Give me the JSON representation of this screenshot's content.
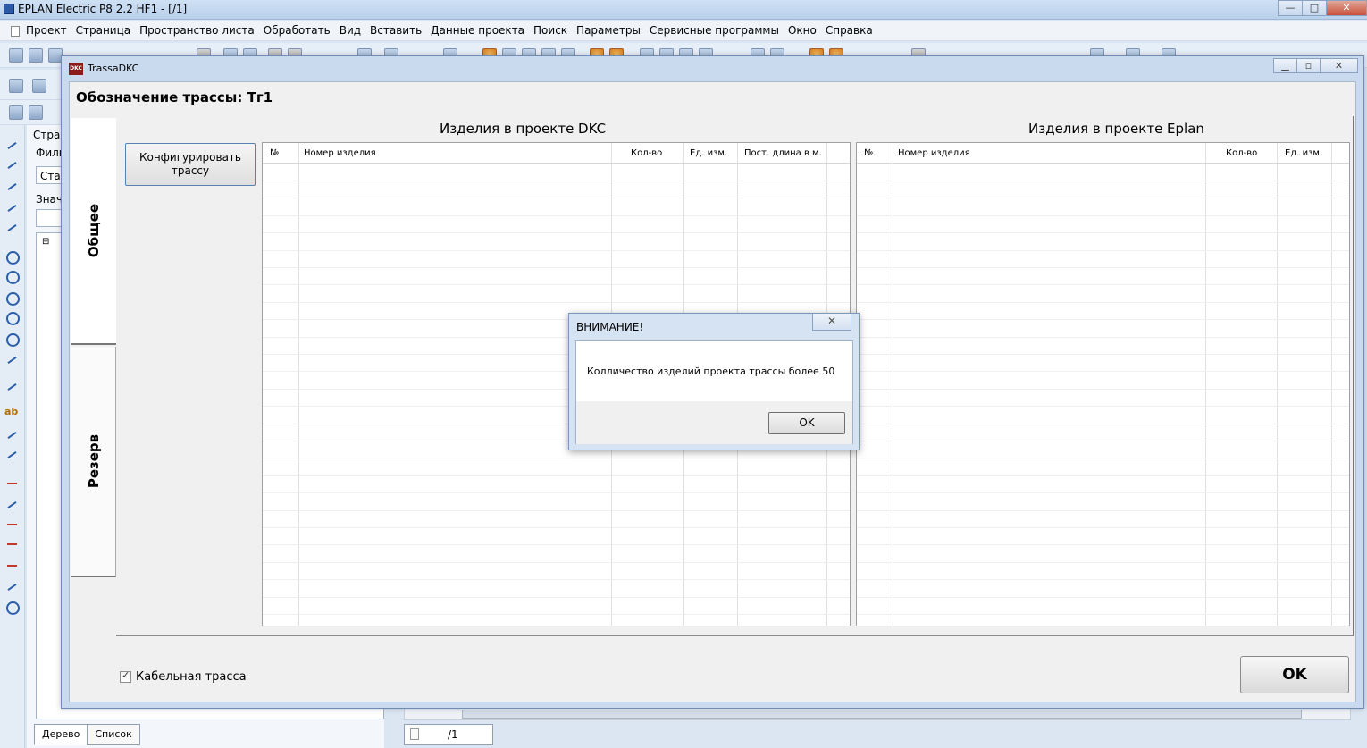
{
  "app": {
    "title": "EPLAN Electric P8 2.2 HF1 - [/1]",
    "menu": [
      "Проект",
      "Страница",
      "Пространство листа",
      "Обработать",
      "Вид",
      "Вставить",
      "Данные проекта",
      "Поиск",
      "Параметры",
      "Сервисные программы",
      "Окно",
      "Справка"
    ]
  },
  "nav_panel": {
    "fragments": [
      "Стран",
      "Филь",
      "Стан",
      "Знач"
    ],
    "tabs": [
      "Дерево",
      "Список"
    ]
  },
  "page_tab": "/1",
  "dialog": {
    "title": "TrassaDKC",
    "icon_text": "DKC",
    "route_title": "Обозначение трассы: Тг1",
    "side_tabs": [
      "Общее",
      "Резерв"
    ],
    "configure_button": "Конфигурировать трассу",
    "dkc_grid": {
      "caption": "Изделия в проекте DKC",
      "columns": [
        "№",
        "Номер изделия",
        "Кол-во",
        "Ед. изм.",
        "Пост. длина в м."
      ]
    },
    "eplan_grid": {
      "caption": "Изделия в проекте Eplan",
      "columns": [
        "№",
        "Номер изделия",
        "Кол-во",
        "Ед. изм."
      ]
    },
    "cable_route_checkbox": {
      "label": "Кабельная трасса",
      "checked": true
    },
    "ok_button": "OK"
  },
  "message_box": {
    "title": "ВНИМАНИЕ!",
    "text": "Колличество изделий проекта трассы более 50",
    "ok_button": "OK",
    "close_symbol": "✕"
  },
  "colors": {
    "dialog_frame": "#c9daee",
    "window_bg": "#f0f0f0",
    "icon_red": "#8b1a1a"
  }
}
